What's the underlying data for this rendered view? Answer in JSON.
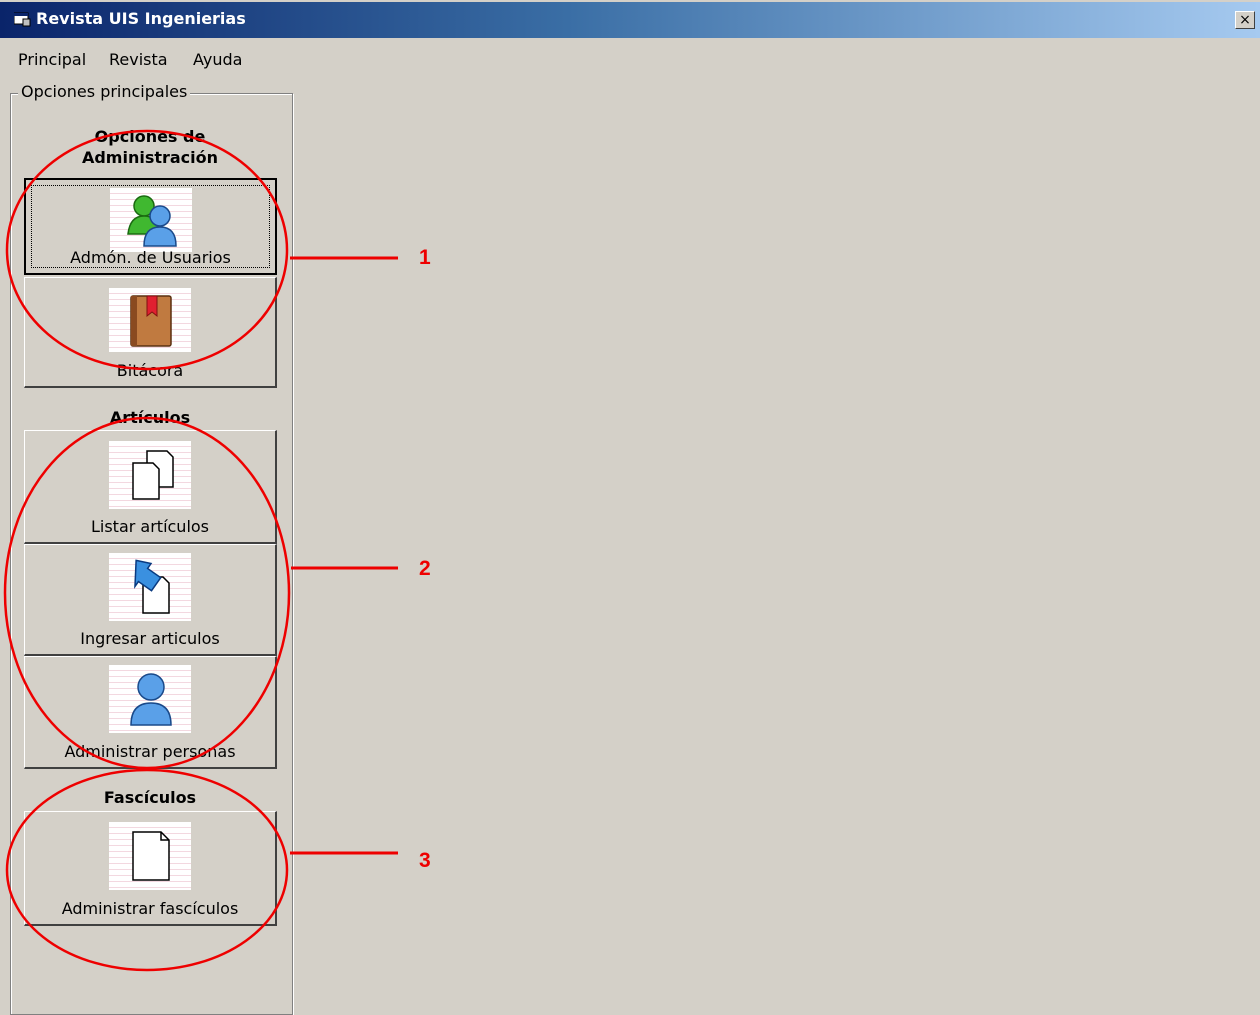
{
  "window": {
    "title": "Revista UIS Ingenierias",
    "close_label": "×"
  },
  "menu": {
    "items": [
      "Principal",
      "Revista",
      "Ayuda"
    ]
  },
  "frame": {
    "label": "Opciones principales"
  },
  "sections": {
    "admin": {
      "title": "Opciones de Administración",
      "buttons": {
        "usuarios": "Admón. de Usuarios",
        "bitacora": "Bitácora"
      }
    },
    "articulos": {
      "title": "Artículos",
      "buttons": {
        "listar": "Listar artículos",
        "ingresar": "Ingresar articulos",
        "personas": "Administrar personas"
      }
    },
    "fasciculos": {
      "title": "Fascículos",
      "buttons": {
        "administrar": "Administrar fascículos"
      }
    }
  },
  "annotations": [
    "1",
    "2",
    "3"
  ],
  "colors": {
    "annotation": "#ee0000",
    "titlebar_start": "#0a246a",
    "titlebar_end": "#a6caf0",
    "face": "#d4d0c8"
  }
}
